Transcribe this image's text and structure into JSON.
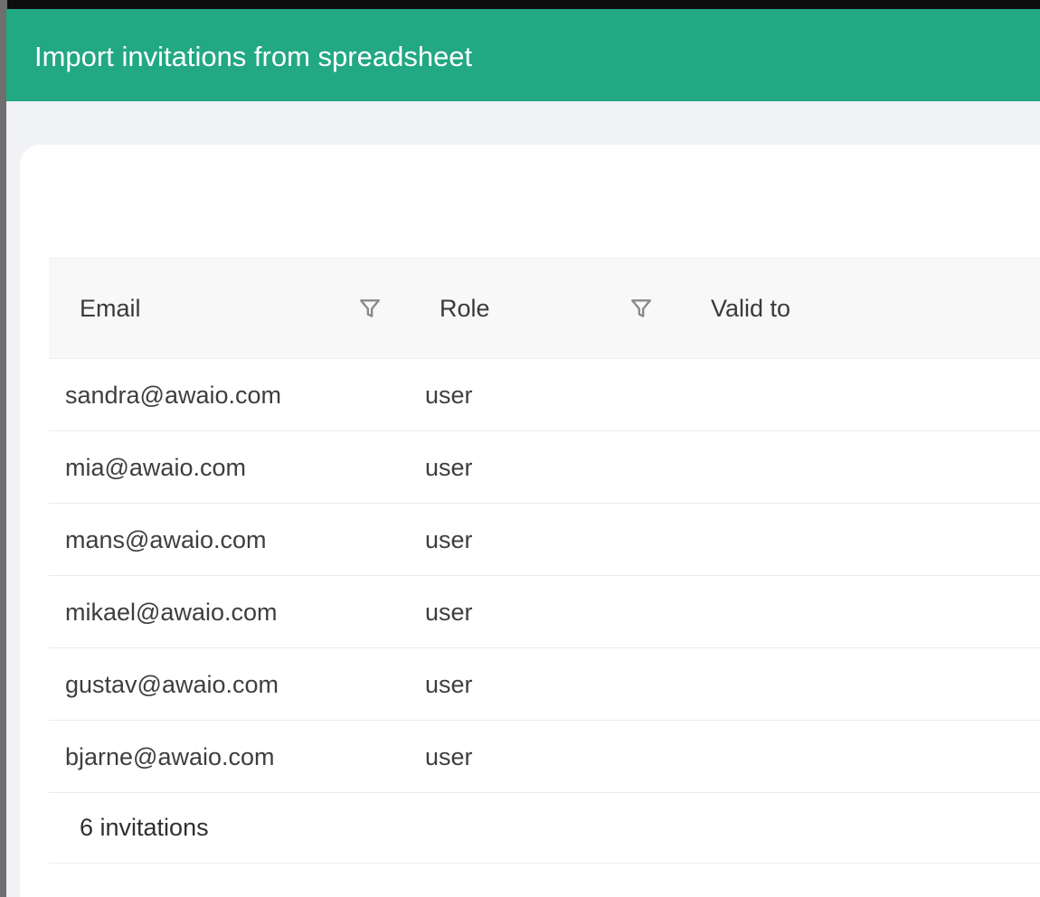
{
  "dialog": {
    "title": "Import invitations from spreadsheet"
  },
  "table": {
    "columns": [
      {
        "label": "Email",
        "filterable": true
      },
      {
        "label": "Role",
        "filterable": true
      },
      {
        "label": "Valid to",
        "filterable": false
      }
    ],
    "rows": [
      {
        "email": "sandra@awaio.com",
        "role": "user",
        "valid_to": ""
      },
      {
        "email": "mia@awaio.com",
        "role": "user",
        "valid_to": ""
      },
      {
        "email": "mans@awaio.com",
        "role": "user",
        "valid_to": ""
      },
      {
        "email": "mikael@awaio.com",
        "role": "user",
        "valid_to": ""
      },
      {
        "email": "gustav@awaio.com",
        "role": "user",
        "valid_to": ""
      },
      {
        "email": "bjarne@awaio.com",
        "role": "user",
        "valid_to": ""
      }
    ],
    "footer": {
      "count_text": "6 invitations"
    }
  },
  "colors": {
    "header_accent": "#22a882",
    "dialog_background": "#f0f2f5",
    "table_header_background": "#f8f8f8",
    "icon_color": "#8a8a8a"
  },
  "icons": {
    "filter": "filter-icon"
  }
}
